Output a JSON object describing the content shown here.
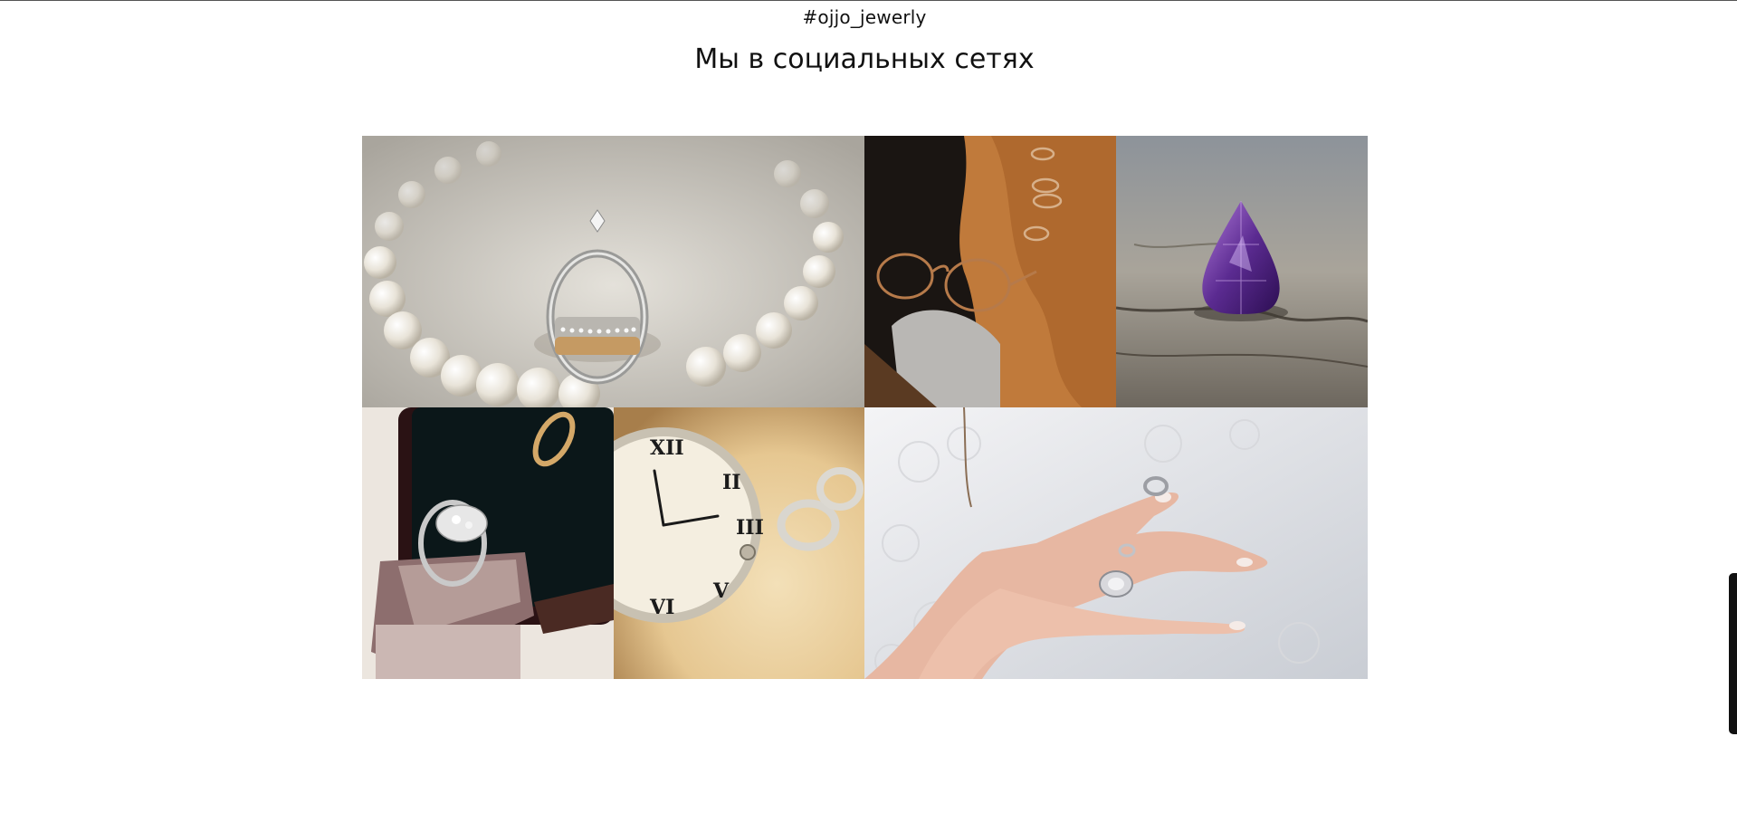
{
  "section": {
    "hashtag": "#ojjo_jewerly",
    "title": "Мы в социальных сетях"
  },
  "gallery": {
    "images": [
      {
        "name": "engagement-rings-on-pearls"
      },
      {
        "name": "rings-and-glasses-on-fabric"
      },
      {
        "name": "amethyst-gem-on-stone"
      },
      {
        "name": "ring-in-velvet-box"
      },
      {
        "name": "watch-and-wedding-bands"
      },
      {
        "name": "bride-hands-with-rings"
      }
    ]
  }
}
